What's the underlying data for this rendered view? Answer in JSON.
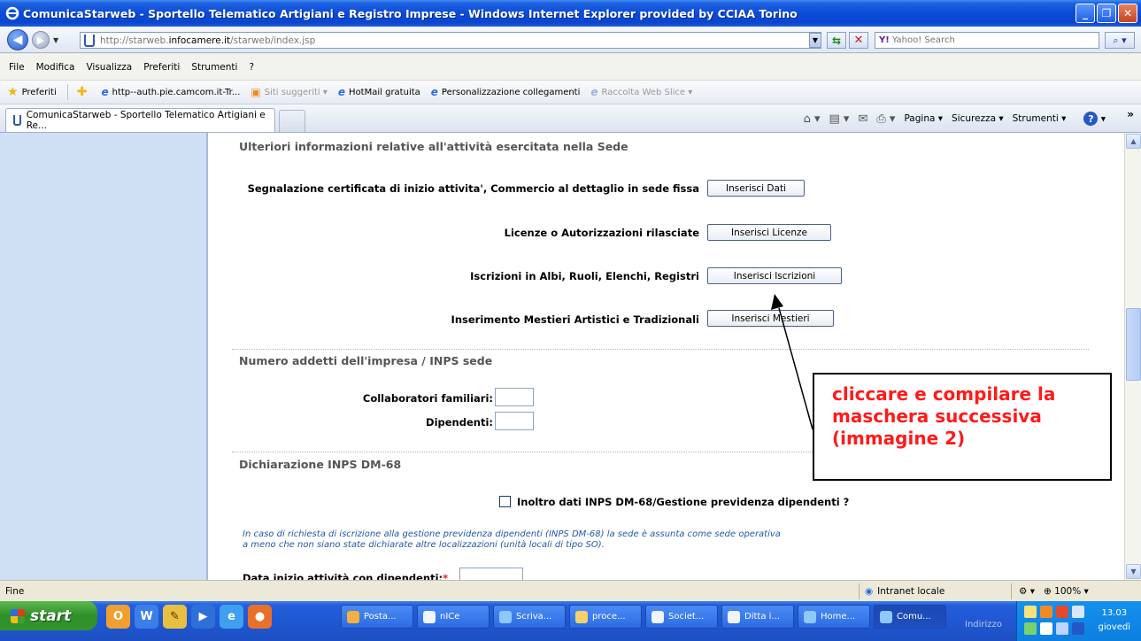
{
  "window": {
    "title": "ComunicaStarweb - Sportello Telematico Artigiani e Registro Imprese - Windows Internet Explorer provided by CCIAA Torino"
  },
  "address": {
    "url_host": "http://starweb.",
    "url_domain": "infocamere.it",
    "url_path": "/starweb/index.jsp",
    "search_placeholder": "Yahoo! Search",
    "search_brand": "Y!"
  },
  "menu": [
    "File",
    "Modifica",
    "Visualizza",
    "Preferiti",
    "Strumenti",
    "?"
  ],
  "favorites": {
    "label": "Preferiti",
    "items": [
      {
        "label": "http--auth.pie.camcom.it-Tr...",
        "gray": false
      },
      {
        "label": "Siti suggeriti ▾",
        "gray": true
      },
      {
        "label": "HotMail gratuita",
        "gray": false
      },
      {
        "label": "Personalizzazione collegamenti",
        "gray": false
      },
      {
        "label": "Raccolta Web Slice ▾",
        "gray": true
      }
    ]
  },
  "tabs": {
    "active_label": "ComunicaStarweb - Sportello Telematico Artigiani e Re..."
  },
  "command_bar": {
    "pagina": "Pagina ▾",
    "sicurezza": "Sicurezza ▾",
    "strumenti": "Strumenti ▾",
    "help": "?"
  },
  "page": {
    "section_activity": "Ulteriori informazioni relative all'attività esercitata nella Sede",
    "rows": [
      {
        "label": "Segnalazione certificata di inizio attivita', Commercio al dettaglio in sede fissa",
        "button": "Inserisci Dati"
      },
      {
        "label": "Licenze o Autorizzazioni rilasciate",
        "button": "Inserisci Licenze"
      },
      {
        "label": "Iscrizioni in Albi, Ruoli, Elenchi, Registri",
        "button": "Inserisci Iscrizioni"
      },
      {
        "label": "Inserimento Mestieri Artistici e Tradizionali",
        "button": "Inserisci Mestieri"
      }
    ],
    "section_inps": "Numero addetti dell'impresa / INPS sede",
    "collaboratori_label": "Collaboratori familiari:",
    "dipendenti_label": "Dipendenti:",
    "section_dm68": "Dichiarazione INPS DM-68",
    "dm68_checkbox_label": "Inoltro dati INPS DM-68/Gestione previdenza dipendenti ?",
    "note_line1": "In caso di richiesta di iscrizione alla gestione previdenza dipendenti (INPS DM-68) la sede è assunta come sede operativa",
    "note_line2": "a meno che non siano state dichiarate altre localizzazioni (unità locali di tipo SO).",
    "partial_label": "Data inizio attività con dipendenti:"
  },
  "callout": {
    "line1": "cliccare e compilare la",
    "line2": "maschera successiva",
    "line3": "(immagine 2)"
  },
  "status": {
    "left": "Fine",
    "zone": "Intranet locale",
    "zoom": "100%"
  },
  "taskbar": {
    "start": "start",
    "tasks": [
      "Posta...",
      "nICe",
      "Scriva...",
      "proce...",
      "Societ...",
      "Ditta i...",
      "Home...",
      "Comu..."
    ],
    "indirizzo": "Indirizzo",
    "time": "13.03",
    "day": "giovedì"
  },
  "colors": {
    "callout_text": "#ff1a1a",
    "note_text": "#1f5aa8",
    "left_panel": "#cfe0f5"
  }
}
